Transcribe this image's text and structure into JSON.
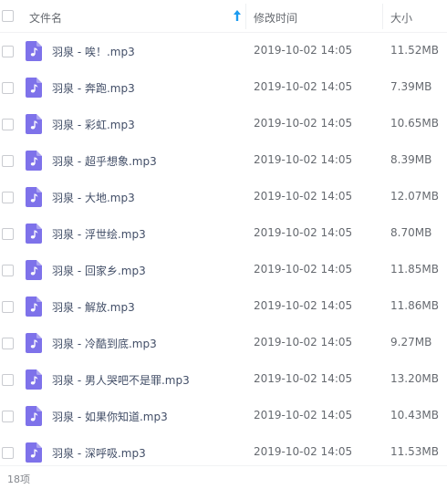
{
  "header": {
    "name_label": "文件名",
    "modified_label": "修改时间",
    "size_label": "大小"
  },
  "files": [
    {
      "name": "羽泉 - 唉！.mp3",
      "modified": "2019-10-02 14:05",
      "size": "11.52MB"
    },
    {
      "name": "羽泉 - 奔跑.mp3",
      "modified": "2019-10-02 14:05",
      "size": "7.39MB"
    },
    {
      "name": "羽泉 - 彩虹.mp3",
      "modified": "2019-10-02 14:05",
      "size": "10.65MB"
    },
    {
      "name": "羽泉 - 超乎想象.mp3",
      "modified": "2019-10-02 14:05",
      "size": "8.39MB"
    },
    {
      "name": "羽泉 - 大地.mp3",
      "modified": "2019-10-02 14:05",
      "size": "12.07MB"
    },
    {
      "name": "羽泉 - 浮世绘.mp3",
      "modified": "2019-10-02 14:05",
      "size": "8.70MB"
    },
    {
      "name": "羽泉 - 回家乡.mp3",
      "modified": "2019-10-02 14:05",
      "size": "11.85MB"
    },
    {
      "name": "羽泉 - 解放.mp3",
      "modified": "2019-10-02 14:05",
      "size": "11.86MB"
    },
    {
      "name": "羽泉 - 冷酷到底.mp3",
      "modified": "2019-10-02 14:05",
      "size": "9.27MB"
    },
    {
      "name": "羽泉 - 男人哭吧不是罪.mp3",
      "modified": "2019-10-02 14:05",
      "size": "13.20MB"
    },
    {
      "name": "羽泉 - 如果你知道.mp3",
      "modified": "2019-10-02 14:05",
      "size": "10.43MB"
    },
    {
      "name": "羽泉 - 深呼吸.mp3",
      "modified": "2019-10-02 14:05",
      "size": "11.53MB"
    }
  ],
  "footer": {
    "count": "18项"
  },
  "colors": {
    "music_icon": "#7e72ea",
    "sort_arrow": "#1c9bf0"
  },
  "icons": {
    "file": "music-file-icon",
    "sort": "sort-ascending-icon"
  }
}
